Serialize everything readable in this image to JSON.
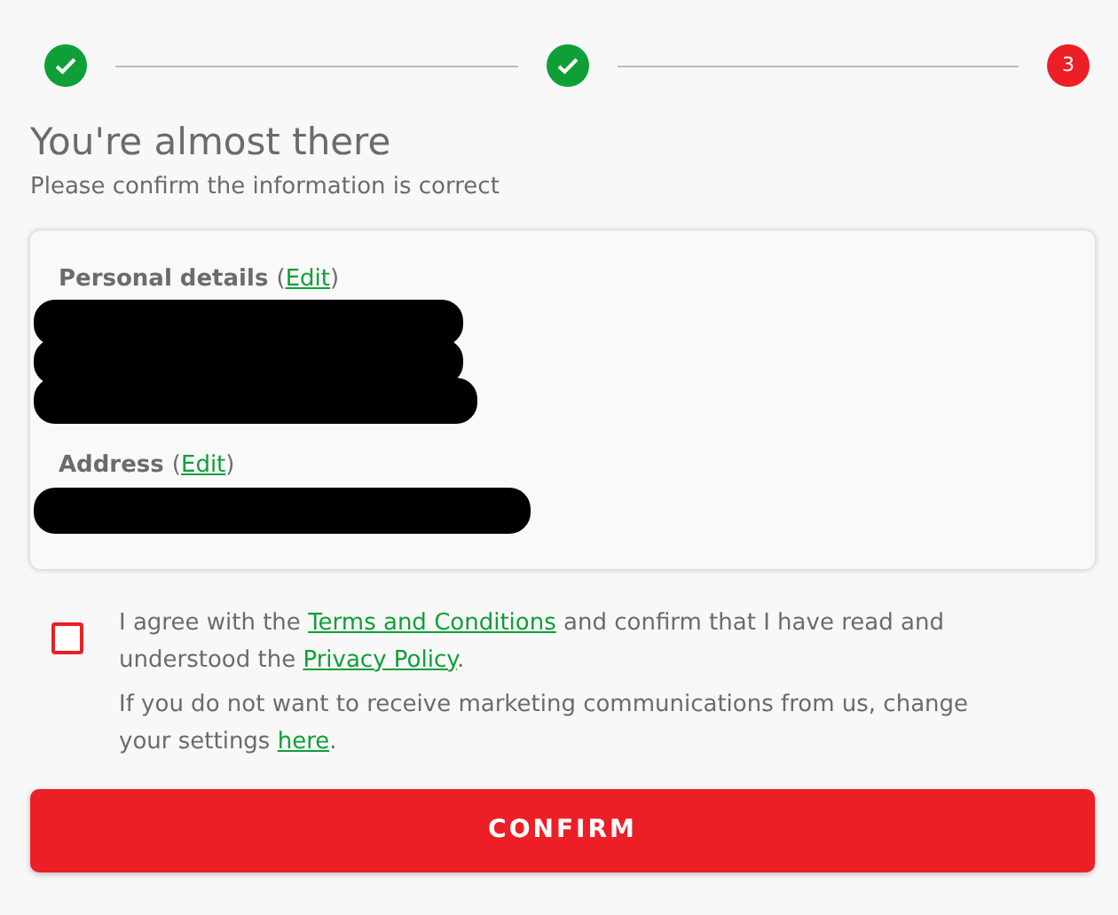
{
  "steps": [
    {
      "kind": "done"
    },
    {
      "kind": "done"
    },
    {
      "kind": "current",
      "label": "3"
    }
  ],
  "title": "You're almost there",
  "subtitle": "Please confirm the information is correct",
  "sections": [
    {
      "heading": [
        {
          "kind": "bold",
          "text": "Personal details "
        },
        {
          "kind": "text",
          "text": "("
        },
        {
          "kind": "link",
          "text": "Edit"
        },
        {
          "kind": "text",
          "text": ")"
        }
      ],
      "content": [
        {
          "kind": "redacted"
        },
        {
          "kind": "redacted"
        },
        {
          "kind": "redacted"
        }
      ]
    },
    {
      "heading": [
        {
          "kind": "bold",
          "text": "Address "
        },
        {
          "kind": "text",
          "text": "("
        },
        {
          "kind": "link",
          "text": "Edit"
        },
        {
          "kind": "text",
          "text": ")"
        }
      ],
      "content": [
        {
          "kind": "redacted"
        }
      ]
    }
  ],
  "agreement": {
    "checked": false,
    "parts": [
      {
        "kind": "text",
        "text": "I agree with the "
      },
      {
        "kind": "link",
        "text": "Terms and Conditions"
      },
      {
        "kind": "text",
        "text": " and confirm that I have read and understood the "
      },
      {
        "kind": "link",
        "text": "Privacy Policy"
      },
      {
        "kind": "text",
        "text": "."
      }
    ]
  },
  "marketing": {
    "parts": [
      {
        "kind": "text",
        "text": "If you do not want to receive marketing communications from us, change your settings "
      },
      {
        "kind": "link",
        "text": "here"
      },
      {
        "kind": "text",
        "text": "."
      }
    ]
  },
  "confirm_button": "CONFIRM"
}
